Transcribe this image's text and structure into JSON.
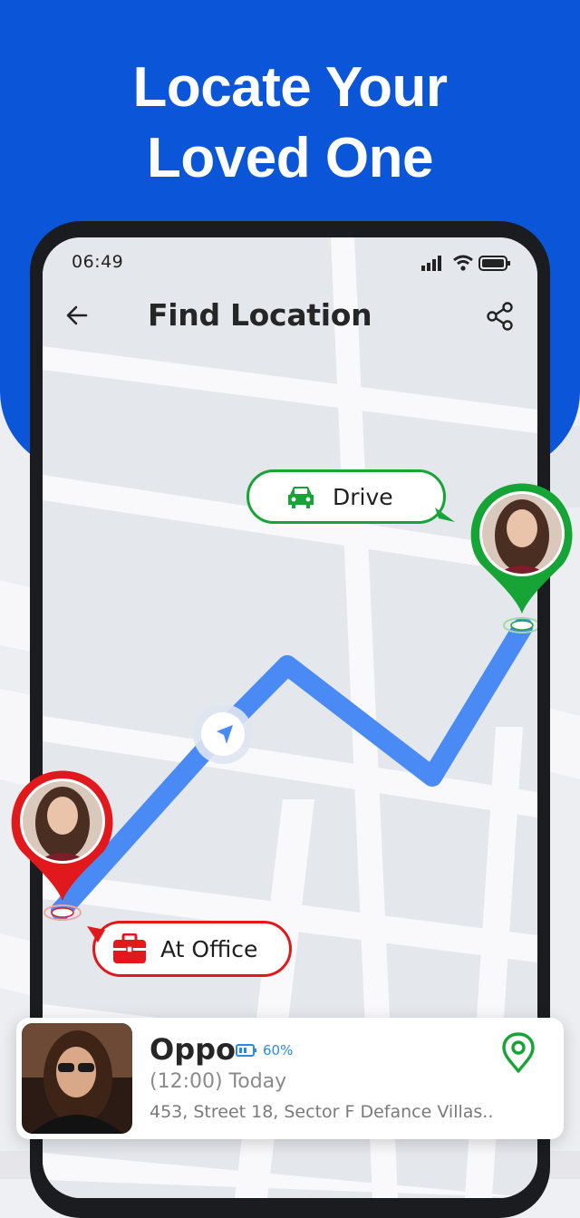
{
  "hero": {
    "title_line1": "Locate Your",
    "title_line2": "Loved One"
  },
  "status_bar": {
    "time": "06:49"
  },
  "app_bar": {
    "title": "Find Location"
  },
  "labels": {
    "drive": "Drive",
    "office": "At Office"
  },
  "card": {
    "name": "Oppo",
    "battery": "60%",
    "time": "(12:00) Today",
    "address": "453, Street 18, Sector F Defance Villas.."
  },
  "colors": {
    "brand_blue": "#0a55d8",
    "route_blue": "#4a8af4",
    "pin_green": "#16a436",
    "pin_red": "#e2191c"
  }
}
